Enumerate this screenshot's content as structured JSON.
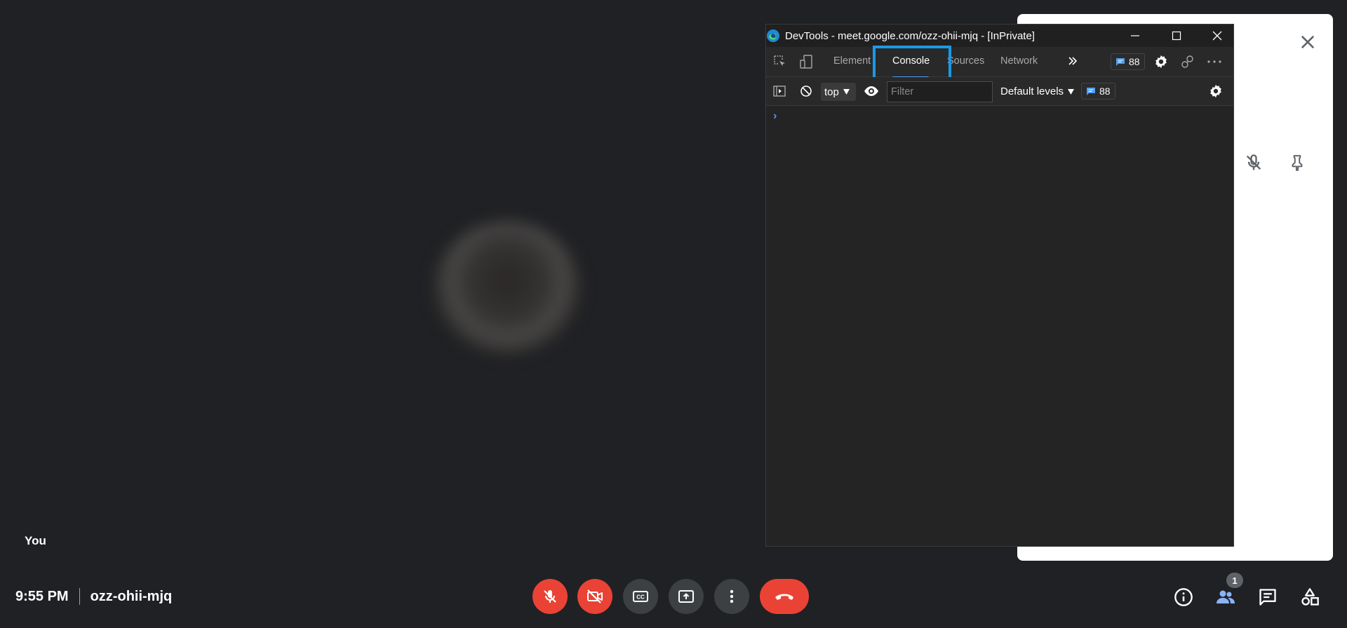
{
  "meeting": {
    "self_label": "You",
    "time": "9:55 PM",
    "code": "ozz-ohii-mjq",
    "participant_count": "1"
  },
  "controls": {
    "mic_icon": "mic-off-icon",
    "camera_icon": "camera-off-icon",
    "captions_icon": "closed-captions-icon",
    "present_icon": "present-screen-icon",
    "more_icon": "more-vert-icon",
    "end_icon": "end-call-icon"
  },
  "devtools": {
    "window_title": "DevTools - meet.google.com/ozz-ohii-mjq - [InPrivate]",
    "tabs": [
      "Element",
      "Console",
      "Sources",
      "Network"
    ],
    "active_tab": "Console",
    "issues_count": "88",
    "context": "top",
    "filter_placeholder": "Filter",
    "levels": "Default levels",
    "console_issues_count": "88",
    "prompt": "›"
  },
  "colors": {
    "background": "#202124",
    "danger": "#ea4335",
    "control_gray": "#3c4043",
    "devtools_accent": "#4d9df5",
    "highlight_box": "#1a99e8",
    "participant_blue": "#8ab4f8"
  }
}
